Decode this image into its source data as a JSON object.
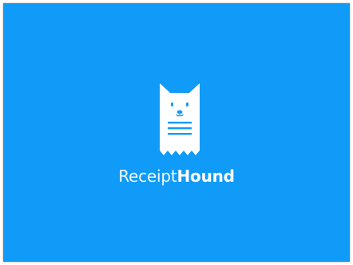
{
  "app": {
    "brand_light": "Receipt",
    "brand_bold": "Hound"
  },
  "logo": {
    "icon": "receipt-hound-logo-icon",
    "color": "#ffffff"
  },
  "theme": {
    "background": "#0f9bf7",
    "accent_text": "#ffffff",
    "line_color": "#0f9bf7"
  }
}
